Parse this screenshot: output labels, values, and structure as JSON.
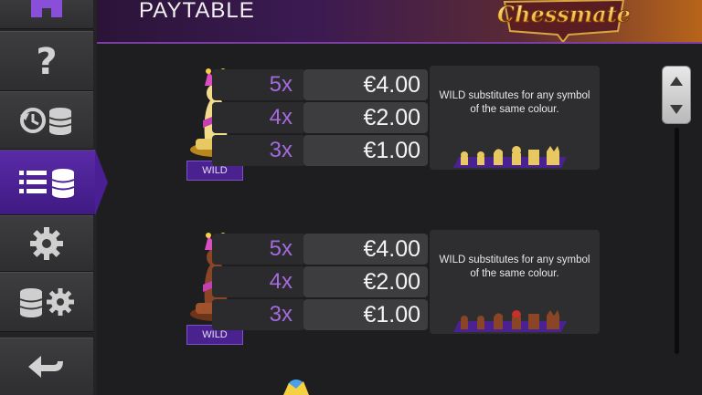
{
  "header": {
    "title": "PAYTABLE",
    "logo_text": "Chessmate"
  },
  "sidebar": {
    "items": [
      {
        "name": "home-icon"
      },
      {
        "name": "help-icon"
      },
      {
        "name": "history-icon"
      },
      {
        "name": "paytable-icon",
        "active": true
      },
      {
        "name": "settings-icon"
      },
      {
        "name": "bet-settings-icon"
      },
      {
        "name": "back-icon"
      }
    ]
  },
  "paytable": {
    "groups": [
      {
        "symbol": "WILD",
        "rows": [
          {
            "mult": "5x",
            "amount": "€4.00"
          },
          {
            "mult": "4x",
            "amount": "€2.00"
          },
          {
            "mult": "3x",
            "amount": "€1.00"
          }
        ],
        "description": "WILD substitutes for any symbol of the same colour.",
        "colour": "#e8c860"
      },
      {
        "symbol": "WILD",
        "rows": [
          {
            "mult": "5x",
            "amount": "€4.00"
          },
          {
            "mult": "4x",
            "amount": "€2.00"
          },
          {
            "mult": "3x",
            "amount": "€1.00"
          }
        ],
        "description": "WILD substitutes for any symbol of the same colour.",
        "colour": "#a0522d"
      }
    ]
  },
  "colors": {
    "accent": "#5a2aa8",
    "multiplier": "#a36bdc"
  }
}
